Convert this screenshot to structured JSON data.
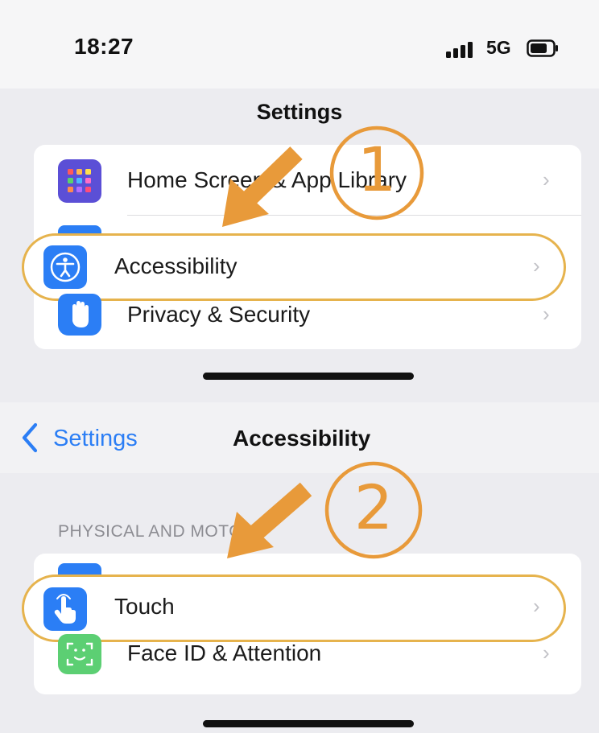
{
  "status_bar": {
    "time": "18:27",
    "network": "5G",
    "signal_icon": "signal-bars-icon",
    "battery_icon": "battery-icon"
  },
  "screen1": {
    "title": "Settings",
    "rows": [
      {
        "label": "Home Screen & App Library",
        "icon": "home-screen-grid-icon"
      },
      {
        "label": "Accessibility",
        "icon": "accessibility-person-icon"
      },
      {
        "label": "Privacy & Security",
        "icon": "privacy-hand-icon"
      }
    ]
  },
  "screen2": {
    "back_label": "Settings",
    "title": "Accessibility",
    "section_header": "PHYSICAL AND MOTOR",
    "rows": [
      {
        "label": "Touch",
        "icon": "touch-hand-icon"
      },
      {
        "label": "Face ID & Attention",
        "icon": "face-id-icon"
      }
    ]
  },
  "annotations": {
    "step1": "1",
    "step2": "2",
    "color": "#e89a3a",
    "highlight_color": "#e6b34d"
  },
  "colors": {
    "accent_blue": "#2b7ef5",
    "home_icon": "#5b4fd6",
    "face_icon": "#5ccf73"
  }
}
